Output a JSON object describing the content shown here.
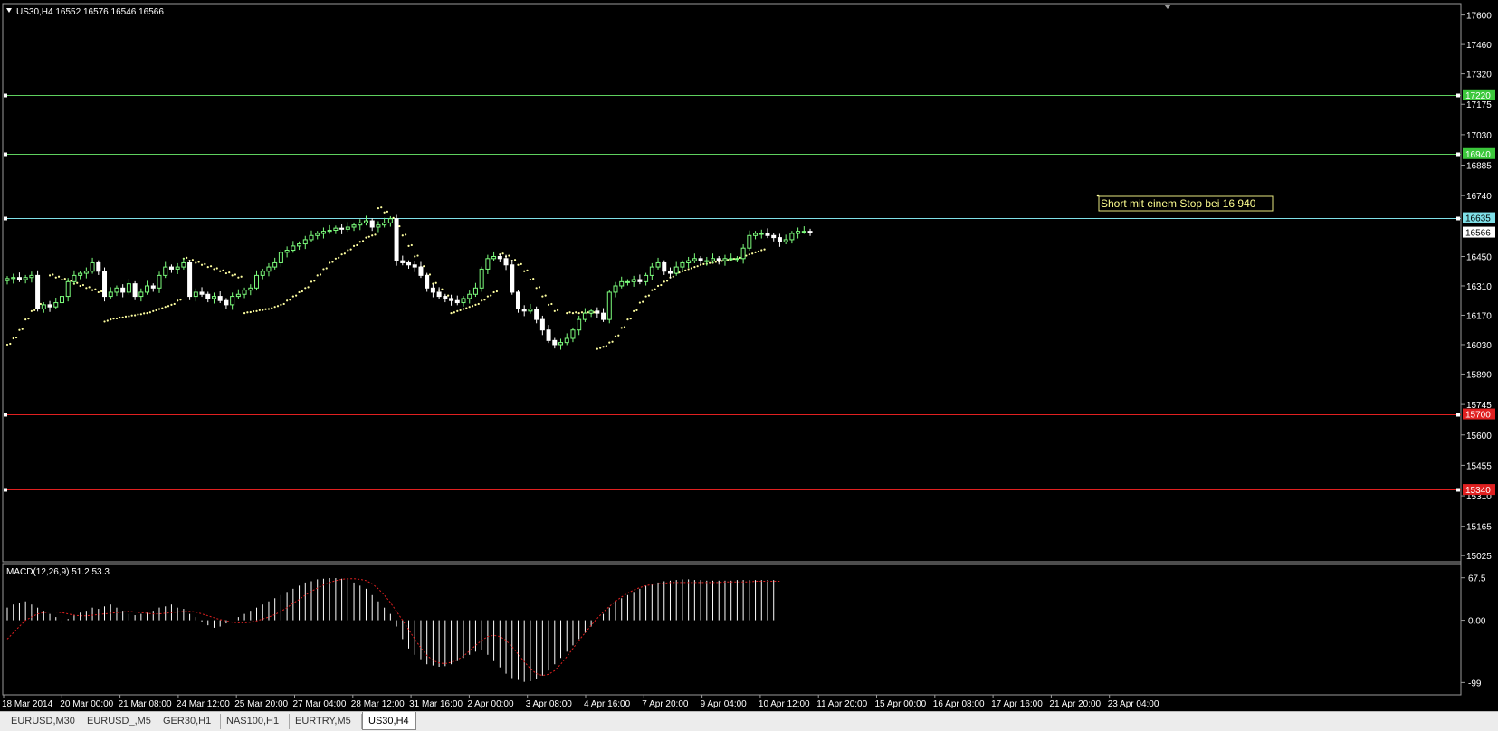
{
  "header": {
    "symbol_text": "US30,H4  16552 16576 16546 16566"
  },
  "annotation": {
    "text": "Short mit einem Stop bei  16 940"
  },
  "colors": {
    "background": "#000000",
    "up_candle": "#7CFC7C",
    "down_candle": "#FFFFFF",
    "resistance": "#5ED05E",
    "support": "#E02020",
    "price_line": "#B8C8E0",
    "sar": "#FFFFA0",
    "macd_hist": "#FFFFFF",
    "macd_signal": "#E02020"
  },
  "price_axis": {
    "ticks": [
      "17600",
      "17460",
      "17320",
      "17175",
      "17030",
      "16885",
      "16740",
      "16450",
      "16310",
      "16170",
      "16030",
      "15890",
      "15745",
      "15600",
      "15455",
      "15310",
      "15165",
      "15025"
    ],
    "labels": [
      {
        "text": "17220",
        "value": 17220,
        "bg": "#3CC83C",
        "fg": "#FFFFFF"
      },
      {
        "text": "16940",
        "value": 16940,
        "bg": "#3CC83C",
        "fg": "#FFFFFF"
      },
      {
        "text": "16635",
        "value": 16635,
        "bg": "#7FE0E8",
        "fg": "#000000"
      },
      {
        "text": "16566",
        "value": 16566,
        "bg": "#FFFFFF",
        "fg": "#000000"
      },
      {
        "text": "15700",
        "value": 15700,
        "bg": "#E02020",
        "fg": "#FFFFFF"
      },
      {
        "text": "15340",
        "value": 15340,
        "bg": "#E02020",
        "fg": "#FFFFFF"
      }
    ]
  },
  "macd_axis": {
    "label": "MACD(12,26,9) 51.2 53.3",
    "ticks": [
      "67.5",
      "0.00",
      "-99"
    ]
  },
  "time_axis": {
    "labels": [
      "18 Mar 2014",
      "20 Mar 00:00",
      "21 Mar 08:00",
      "24 Mar 12:00",
      "25 Mar 20:00",
      "27 Mar 04:00",
      "28 Mar 12:00",
      "31 Mar 16:00",
      "2 Apr 00:00",
      "3 Apr 08:00",
      "4 Apr 16:00",
      "7 Apr 20:00",
      "9 Apr 04:00",
      "10 Apr 12:00",
      "11 Apr 20:00",
      "15 Apr 00:00",
      "16 Apr 08:00",
      "17 Apr 16:00",
      "21 Apr 20:00",
      "23 Apr 04:00"
    ]
  },
  "tabs": [
    {
      "label": "EURUSD,M30",
      "active": false
    },
    {
      "label": "EURUSD_,M5",
      "active": false
    },
    {
      "label": "GER30,H1",
      "active": false
    },
    {
      "label": "NAS100,H1",
      "active": false
    },
    {
      "label": "EURTRY,M5",
      "active": false
    },
    {
      "label": "US30,H4",
      "active": true
    }
  ],
  "chart_data": {
    "type": "candlestick",
    "symbol": "US30",
    "timeframe": "H4",
    "ylim": [
      15000,
      17650
    ],
    "horizontal_lines": [
      {
        "value": 17220,
        "kind": "resistance"
      },
      {
        "value": 16940,
        "kind": "resistance"
      },
      {
        "value": 16635,
        "kind": "level"
      },
      {
        "value": 16566,
        "kind": "current_price"
      },
      {
        "value": 15700,
        "kind": "support"
      },
      {
        "value": 15340,
        "kind": "support"
      }
    ],
    "close_path": [
      16345,
      16350,
      16340,
      16350,
      16360,
      16200,
      16220,
      16210,
      16230,
      16260,
      16330,
      16360,
      16370,
      16380,
      16420,
      16380,
      16260,
      16280,
      16300,
      16280,
      16320,
      16260,
      16280,
      16310,
      16300,
      16360,
      16400,
      16390,
      16400,
      16420,
      16260,
      16280,
      16270,
      16250,
      16260,
      16240,
      16220,
      16260,
      16270,
      16290,
      16300,
      16360,
      16380,
      16400,
      16420,
      16470,
      16480,
      16500,
      16510,
      16530,
      16550,
      16560,
      16570,
      16575,
      16585,
      16580,
      16590,
      16600,
      16610,
      16620,
      16590,
      16600,
      16610,
      16630,
      16430,
      16420,
      16410,
      16400,
      16360,
      16300,
      16280,
      16260,
      16250,
      16240,
      16230,
      16250,
      16270,
      16300,
      16390,
      16440,
      16450,
      16440,
      16410,
      16280,
      16200,
      16190,
      16200,
      16150,
      16100,
      16050,
      16030,
      16040,
      16060,
      16100,
      16150,
      16180,
      16190,
      16180,
      16150,
      16280,
      16310,
      16330,
      16330,
      16340,
      16330,
      16360,
      16400,
      16420,
      16380,
      16370,
      16400,
      16420,
      16430,
      16440,
      16430,
      16430,
      16440,
      16430,
      16440,
      16440,
      16440,
      16490,
      16550,
      16560,
      16560,
      16550,
      16540,
      16520,
      16530,
      16560,
      16570,
      16570,
      16566
    ],
    "sar_segments": [
      {
        "start": 0,
        "values": [
          16030,
          16060,
          16100,
          16150,
          16190,
          16220
        ]
      },
      {
        "start": 7,
        "values": [
          16360,
          16350,
          16340,
          16330,
          16320,
          16310,
          16300,
          16290,
          16280
        ]
      },
      {
        "start": 16,
        "values": [
          16140,
          16150,
          16155,
          16160,
          16165,
          16170,
          16175,
          16180,
          16190,
          16200,
          16210,
          16220,
          16240
        ]
      },
      {
        "start": 29,
        "values": [
          16440,
          16430,
          16420,
          16410,
          16400,
          16390,
          16380,
          16370,
          16360,
          16350
        ]
      },
      {
        "start": 39,
        "values": [
          16180,
          16185,
          16190,
          16195,
          16200,
          16210,
          16220,
          16240,
          16260,
          16280,
          16300,
          16330,
          16360,
          16390,
          16420,
          16440,
          16460,
          16480,
          16500,
          16520,
          16540,
          16550
        ]
      },
      {
        "start": 61,
        "values": [
          16680,
          16660,
          16630,
          16590,
          16550,
          16500,
          16450,
          16400,
          16360,
          16320,
          16290,
          16260
        ]
      },
      {
        "start": 73,
        "values": [
          16180,
          16190,
          16200,
          16210,
          16220,
          16240,
          16260,
          16280
        ]
      },
      {
        "start": 81,
        "values": [
          16460,
          16450,
          16430,
          16410,
          16380,
          16340,
          16300,
          16260,
          16220,
          16190
        ]
      },
      {
        "start": 92,
        "values": [
          16180,
          16180,
          16180,
          16180,
          16180
        ]
      },
      {
        "start": 97,
        "values": [
          16010,
          16020,
          16040,
          16070,
          16110,
          16150,
          16190,
          16230,
          16260,
          16290,
          16310,
          16330,
          16350,
          16370,
          16380,
          16390,
          16400,
          16410,
          16415,
          16420,
          16425,
          16430,
          16435,
          16440,
          16450,
          16460,
          16470,
          16480
        ]
      }
    ],
    "macd": {
      "hist_ylim": [
        -110,
        80
      ],
      "histogram": [
        20,
        25,
        28,
        30,
        25,
        20,
        15,
        10,
        5,
        -5,
        2,
        8,
        12,
        15,
        20,
        18,
        22,
        25,
        20,
        15,
        10,
        8,
        10,
        12,
        15,
        20,
        22,
        25,
        20,
        18,
        10,
        5,
        -2,
        -8,
        -12,
        -10,
        -5,
        0,
        5,
        10,
        15,
        20,
        25,
        30,
        35,
        40,
        45,
        50,
        55,
        60,
        62,
        65,
        66,
        67,
        67,
        66,
        65,
        60,
        55,
        50,
        40,
        30,
        20,
        10,
        -10,
        -30,
        -45,
        -55,
        -62,
        -70,
        -72,
        -74,
        -73,
        -70,
        -65,
        -60,
        -55,
        -50,
        -48,
        -55,
        -65,
        -75,
        -85,
        -92,
        -95,
        -98,
        -97,
        -94,
        -88,
        -80,
        -70,
        -60,
        -50,
        -40,
        -30,
        -20,
        -10,
        0,
        10,
        20,
        30,
        35,
        40,
        45,
        50,
        55,
        58,
        60,
        62,
        63,
        64,
        65,
        65,
        64,
        64,
        63,
        63,
        63,
        63,
        63,
        64,
        64,
        64,
        64,
        64,
        64,
        64
      ],
      "signal": [
        -30,
        -20,
        -10,
        0,
        5,
        10,
        12,
        13,
        13,
        12,
        10,
        8,
        7,
        7,
        8,
        9,
        10,
        11,
        12,
        13,
        14,
        13,
        12,
        11,
        10,
        10,
        11,
        12,
        13,
        14,
        14,
        13,
        10,
        7,
        4,
        1,
        -1,
        -3,
        -4,
        -4,
        -3,
        -1,
        2,
        5,
        9,
        14,
        20,
        27,
        33,
        40,
        46,
        51,
        56,
        60,
        63,
        65,
        66,
        66,
        65,
        63,
        58,
        50,
        40,
        28,
        14,
        0,
        -15,
        -30,
        -44,
        -56,
        -64,
        -68,
        -69,
        -67,
        -63,
        -57,
        -49,
        -40,
        -32,
        -26,
        -24,
        -26,
        -32,
        -42,
        -54,
        -66,
        -77,
        -85,
        -88,
        -86,
        -80,
        -70,
        -58,
        -45,
        -32,
        -20,
        -8,
        3,
        13,
        22,
        30,
        37,
        43,
        48,
        52,
        55,
        57,
        58,
        59,
        60,
        60,
        60,
        60,
        60,
        60,
        60,
        60,
        60,
        61,
        61,
        61,
        61,
        61,
        62,
        62,
        62,
        62,
        62
      ]
    }
  }
}
